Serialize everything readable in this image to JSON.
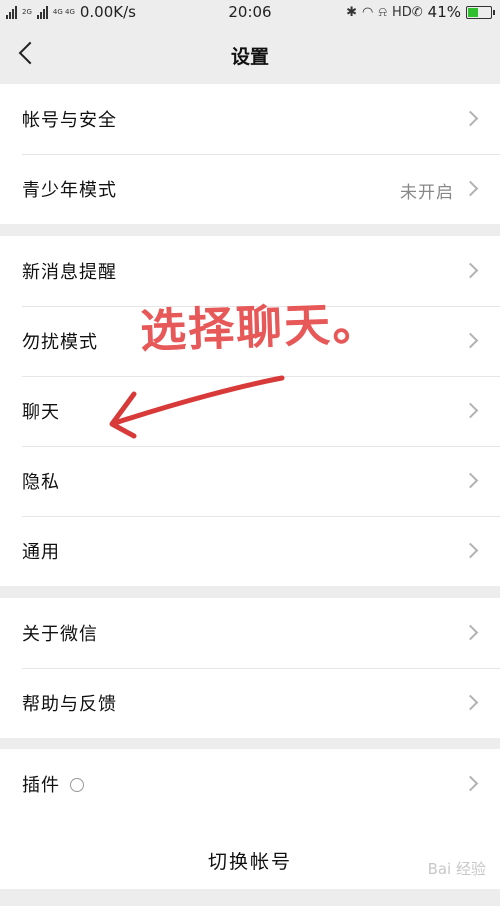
{
  "status_bar": {
    "network_left": "2G",
    "network_right": "4G 4G",
    "speed": "0.00K/s",
    "time": "20:06",
    "icons": [
      "bluetooth-icon",
      "headset-icon",
      "mute-bell-icon",
      "hd-call-icon"
    ],
    "hd_label": "HD",
    "battery": "41%",
    "battery_level": 0.41
  },
  "header": {
    "title": "设置"
  },
  "groups": [
    {
      "items": [
        {
          "label": "帐号与安全"
        },
        {
          "label": "青少年模式",
          "value": "未开启"
        }
      ]
    },
    {
      "items": [
        {
          "label": "新消息提醒"
        },
        {
          "label": "勿扰模式"
        },
        {
          "label": "聊天"
        },
        {
          "label": "隐私"
        },
        {
          "label": "通用"
        }
      ]
    },
    {
      "items": [
        {
          "label": "关于微信"
        },
        {
          "label": "帮助与反馈"
        }
      ]
    },
    {
      "items": [
        {
          "label": "插件",
          "icon": "plugin-icon"
        }
      ]
    }
  ],
  "switch_account": "切换帐号",
  "annotation": {
    "text": "选择聊天。",
    "color": "#e64a4a"
  },
  "watermark": "Bai 经验"
}
